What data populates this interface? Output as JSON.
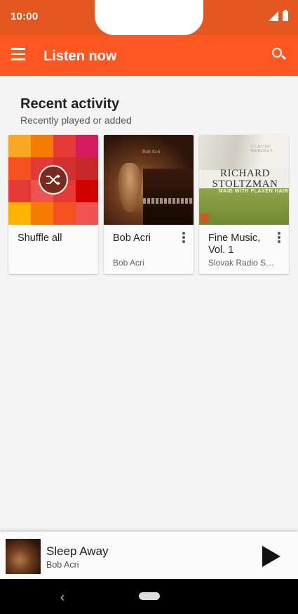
{
  "status_bar": {
    "time": "10:00"
  },
  "app_bar": {
    "title": "Listen now"
  },
  "section": {
    "title": "Recent activity",
    "subtitle": "Recently played or added"
  },
  "cards": [
    {
      "title": "Shuffle all",
      "subtitle": ""
    },
    {
      "title": "Bob Acri",
      "subtitle": "Bob Acri",
      "art_text": "Bob Acri"
    },
    {
      "title": "Fine Music, Vol. 1",
      "subtitle": "Slovak Radio Sy...",
      "art": {
        "composer": "CLAUDE DEBUSSY",
        "performer": "RICHARD STOLTZMAN",
        "piece": "MAID WITH FLAXEN HAIR"
      }
    }
  ],
  "now_playing": {
    "title": "Sleep Away",
    "artist": "Bob Acri"
  },
  "colors": {
    "status_bar": "#e4561f",
    "app_bar": "#ff5722",
    "background": "#f4f4f4"
  }
}
